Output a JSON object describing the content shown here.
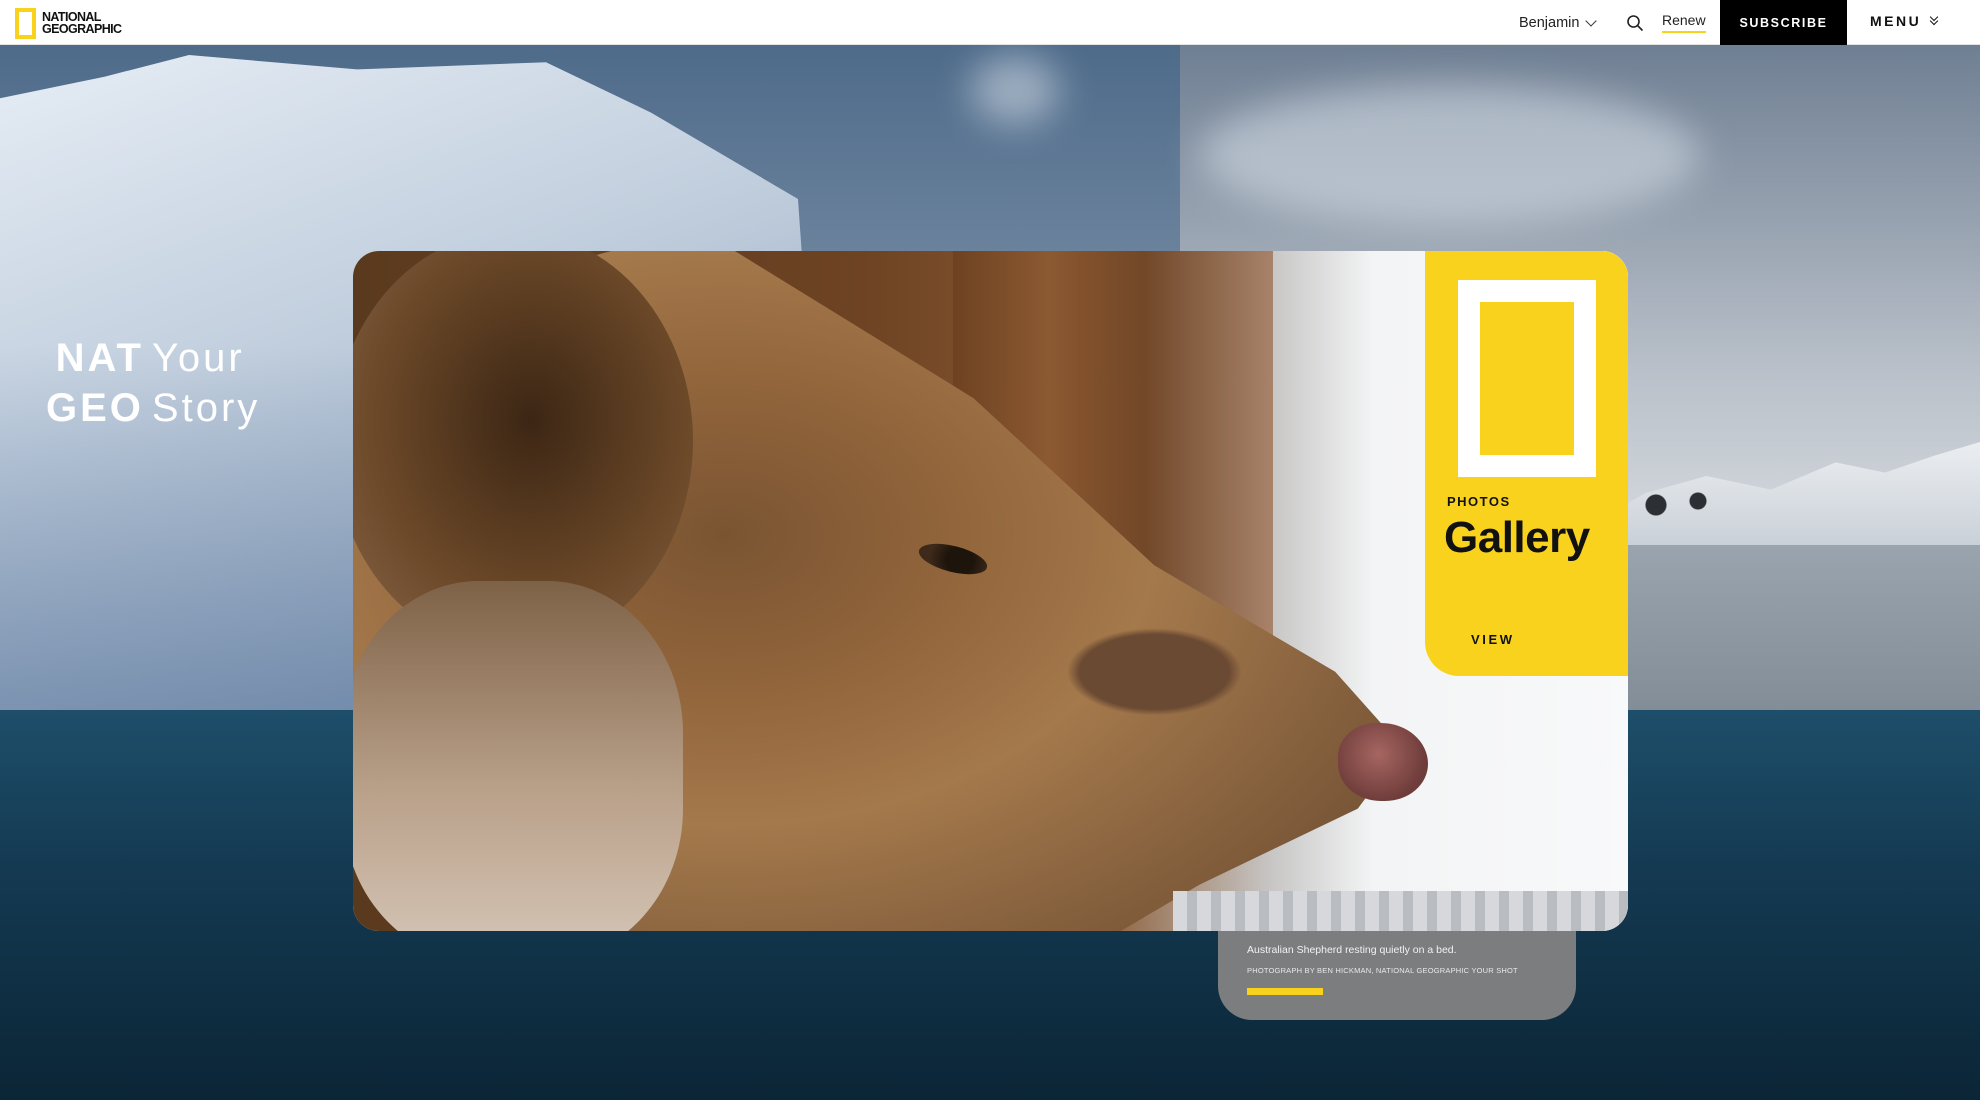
{
  "header": {
    "logo_line1": "NATIONAL",
    "logo_line2": "GEOGRAPHIC",
    "user_name": "Benjamin",
    "renew_label": "Renew",
    "subscribe_label": "SUBSCRIBE",
    "menu_label": "MENU"
  },
  "brand": {
    "word1": "NAT",
    "word2": "Your",
    "word3": "GEO",
    "word4": "Story"
  },
  "card": {
    "kicker": "PHOTOS",
    "title": "Gallery",
    "view_label": "VIEW"
  },
  "caption": {
    "text": "Australian Shepherd resting quietly on a bed.",
    "credit": "PHOTOGRAPH BY BEN HICKMAN, NATIONAL GEOGRAPHIC YOUR SHOT"
  },
  "colors": {
    "brand_yellow": "#f9d21e",
    "subscribe_bg": "#000000",
    "caption_bg": "#7c7d7f"
  },
  "icons": {
    "search": "search-icon",
    "user_dropdown": "chevron-down-icon",
    "menu_toggle": "double-chevron-down-icon"
  }
}
